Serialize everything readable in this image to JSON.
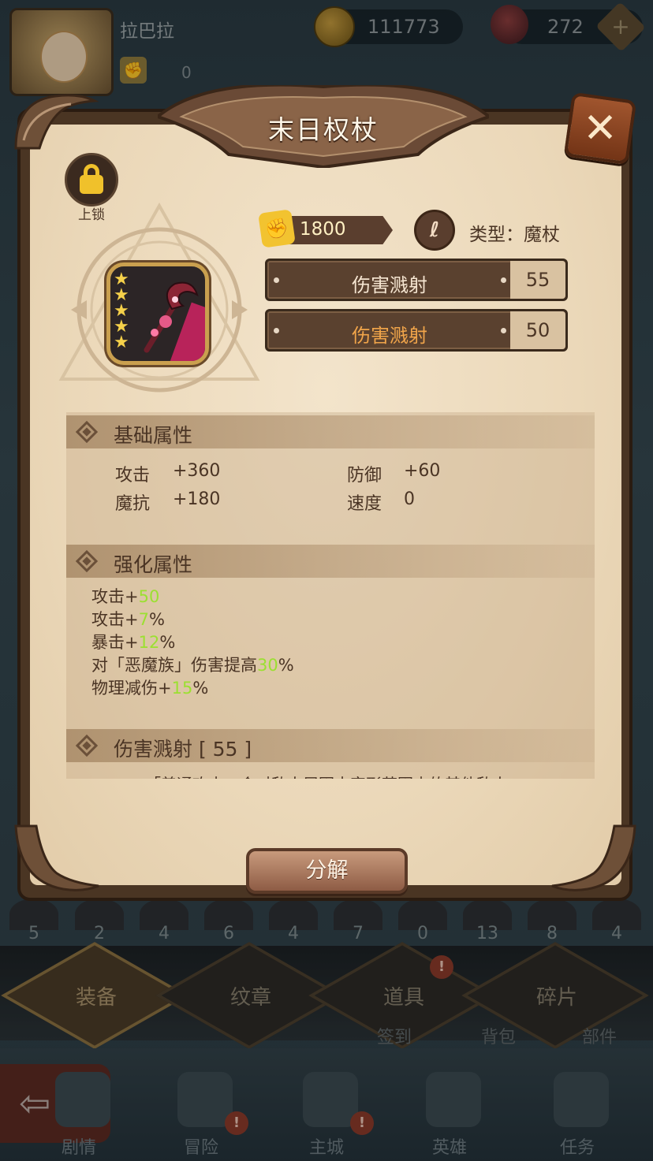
{
  "background": {
    "player_name": "拉巴拉",
    "player_stat": "0",
    "gold": "111773",
    "gems": "272",
    "slot_counts": [
      "5",
      "2",
      "4",
      "6",
      "4",
      "7",
      "0",
      "13",
      "8",
      "4"
    ],
    "tabs": [
      {
        "label": "装备",
        "active": true
      },
      {
        "label": "纹章",
        "active": false
      },
      {
        "label": "道具",
        "active": false
      },
      {
        "label": "碎片",
        "active": false
      }
    ],
    "sublabels": [
      "签到",
      "背包",
      "部件"
    ],
    "nav": [
      "剧情",
      "冒险",
      "主城",
      "英雄",
      "任务"
    ]
  },
  "modal": {
    "title": "末日权杖",
    "close_icon": "close-icon",
    "lock_label": "上锁",
    "power": "1800",
    "type_label": "类型：魔杖",
    "skills": [
      {
        "name": "伤害溅射",
        "level": "55",
        "color": "#f6e6d2"
      },
      {
        "name": "伤害溅射",
        "level": "50",
        "color": "#f1a54a"
      }
    ],
    "stars": 5,
    "base_section_title": "基础属性",
    "base_attrs": [
      {
        "label": "攻击",
        "value": "+360"
      },
      {
        "label": "防御",
        "value": "+60"
      },
      {
        "label": "魔抗",
        "value": "+180"
      },
      {
        "label": "速度",
        "value": "0"
      }
    ],
    "enhance_section_title": "强化属性",
    "enhance_attrs": [
      {
        "prefix": "攻击+",
        "value": "50",
        "suffix": ""
      },
      {
        "prefix": "攻击+",
        "value": "7",
        "suffix": "%"
      },
      {
        "prefix": "暴击+",
        "value": "12",
        "suffix": "%"
      },
      {
        "prefix": "对「恶魔族」伤害提高",
        "value": "30",
        "suffix": "%"
      },
      {
        "prefix": "物理减伤+",
        "value": "15",
        "suffix": "%"
      }
    ],
    "skill_section_title": "伤害溅射 [ 55 ]",
    "skill_desc_cut": "「普通攻击」会对敌人周围十字形范围内的其他敌人",
    "decompose_label": "分解",
    "accent_colors": {
      "highlight": "#9be031",
      "gold": "#f2c330"
    }
  }
}
